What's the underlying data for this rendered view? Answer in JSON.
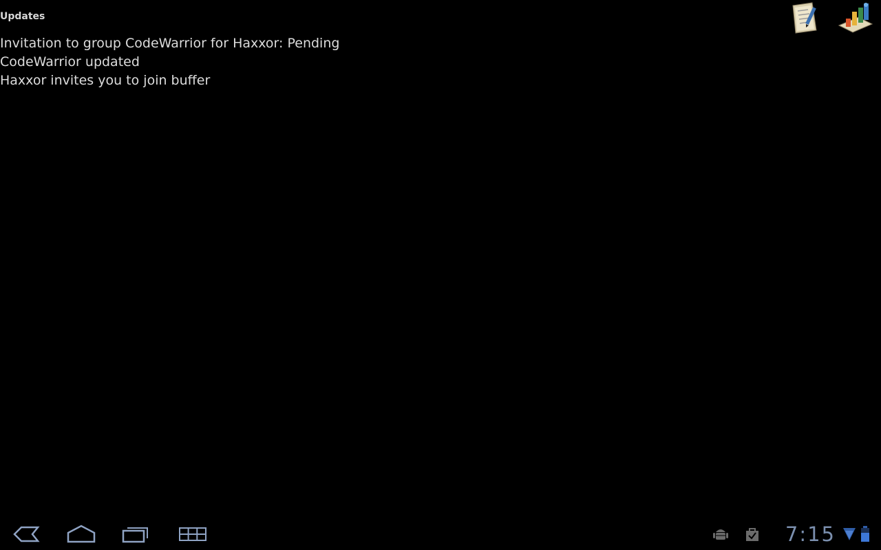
{
  "header": {
    "title": "Updates",
    "actions": [
      {
        "icon": "notepad-icon"
      },
      {
        "icon": "bar-chart-icon"
      }
    ]
  },
  "updates": [
    "Invitation to group CodeWarrior for Haxxor: Pending",
    "CodeWarrior updated",
    "Haxxor invites you to join buffer"
  ],
  "system_bar": {
    "nav_buttons": [
      "back-icon",
      "home-icon",
      "recent-apps-icon",
      "menu-icon"
    ],
    "status_icons": [
      "android-debug-icon",
      "store-bag-icon",
      "wifi-icon",
      "battery-icon"
    ],
    "clock": "7:15",
    "accent_color": "#7b8fae"
  }
}
